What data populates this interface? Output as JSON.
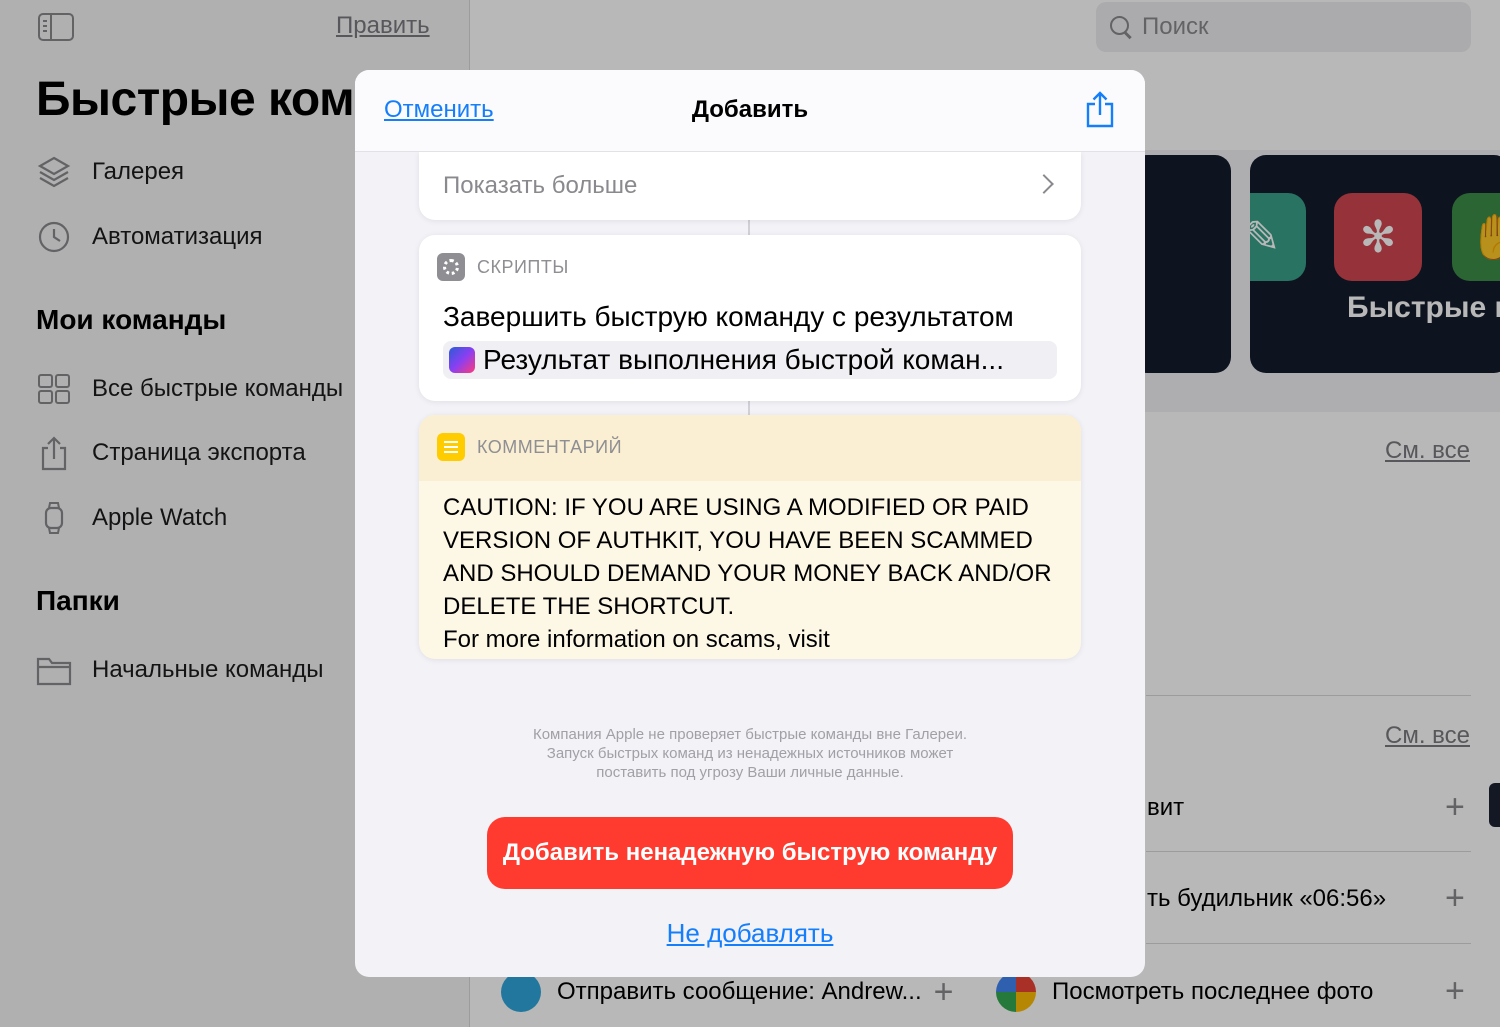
{
  "sidebar": {
    "edit_label": "Править",
    "title": "Быстрые ком",
    "items_top": [
      {
        "icon": "layers-icon",
        "label": "Галерея"
      },
      {
        "icon": "clock-icon",
        "label": "Автоматизация"
      }
    ],
    "my_commands_heading": "Мои команды",
    "items_my": [
      {
        "icon": "grid-icon",
        "label": "Все быстрые команды"
      },
      {
        "icon": "share-icon",
        "label": "Страница экспорта"
      },
      {
        "icon": "watch-icon",
        "label": "Apple Watch"
      }
    ],
    "folders_heading": "Папки",
    "items_folders": [
      {
        "icon": "folder-icon",
        "label": "Начальные команды"
      }
    ]
  },
  "main": {
    "search_placeholder": "Поиск",
    "gallery_card_title": "Быстрые к",
    "see_all_1": "См. все",
    "see_all_2": "См. все",
    "row_1": "вит",
    "row_2": "ть будильник «06:56»",
    "bottom_1": "Отправить сообщение: Andrew...",
    "bottom_2": "Посмотреть последнее фото"
  },
  "modal": {
    "cancel_label": "Отменить",
    "title": "Добавить",
    "show_more": "Показать больше",
    "script_category": "СКРИПТЫ",
    "action_title": "Завершить быструю команду с результатом",
    "token_text": "Результат выполнения быстрой коман...",
    "comment_category": "КОММЕНТАРИЙ",
    "comment_lines": [
      "CAUTION: IF YOU ARE USING A MODIFIED OR PAID",
      "VERSION OF AUTHKIT, YOU HAVE BEEN SCAMMED",
      "AND SHOULD DEMAND YOUR MONEY BACK AND/OR",
      "DELETE THE SHORTCUT.",
      "For more information on scams, visit"
    ],
    "warning_lines": [
      "Компания Apple не проверяет быстрые команды вне Галереи.",
      "Запуск быстрых команд из ненадежных источников может",
      "поставить под угрозу Ваши личные данные."
    ],
    "add_button": "Добавить ненадежную быструю команду",
    "dont_add": "Не добавлять"
  },
  "colors": {
    "accent_blue": "#147efb",
    "danger_red": "#ff3b30",
    "comment_bg": "#fdf7e6"
  }
}
